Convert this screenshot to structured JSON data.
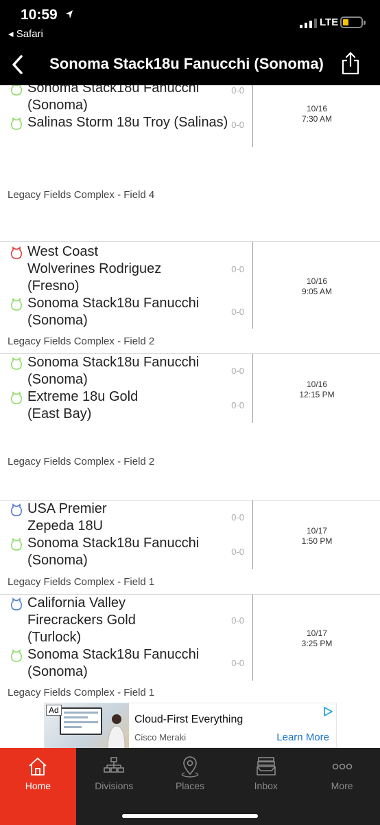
{
  "status_bar": {
    "time": "10:59",
    "back_app": "◂ Safari",
    "network": "LTE"
  },
  "nav": {
    "title": "Sonoma Stack18u Fanucchi (Sonoma)"
  },
  "games": [
    {
      "team1": {
        "name": "Sonoma Stack18u Fanucchi (Sonoma)",
        "score": "0-0",
        "icon_color": "#8fdc6a"
      },
      "team2": {
        "name": "Salinas Storm 18u Troy (Salinas)",
        "score": "0-0",
        "icon_color": "#8fdc6a"
      },
      "date": "10/16",
      "time": "7:30 AM",
      "venue": "Legacy Fields Complex - Field 4"
    },
    {
      "team1": {
        "name": "West Coast Wolverines Rodriguez (Fresno)",
        "score": "0-0",
        "icon_color": "#e23b3b"
      },
      "team2": {
        "name": "Sonoma Stack18u Fanucchi (Sonoma)",
        "score": "0-0",
        "icon_color": "#8fdc6a"
      },
      "date": "10/16",
      "time": "9:05 AM",
      "venue": "Legacy Fields Complex - Field 2"
    },
    {
      "team1": {
        "name": "Sonoma Stack18u Fanucchi (Sonoma)",
        "score": "0-0",
        "icon_color": "#8fdc6a"
      },
      "team2": {
        "name": "Extreme 18u Gold (East Bay)",
        "score": "0-0",
        "icon_color": "#8fdc6a"
      },
      "date": "10/16",
      "time": "12:15 PM",
      "venue": "Legacy Fields Complex - Field 2"
    },
    {
      "team1": {
        "name": "USA Premier Zepeda 18U",
        "score": "0-0",
        "icon_color": "#5a78d6"
      },
      "team2": {
        "name": "Sonoma Stack18u Fanucchi (Sonoma)",
        "score": "0-0",
        "icon_color": "#8fdc6a"
      },
      "date": "10/17",
      "time": "1:50 PM",
      "venue": "Legacy Fields Complex - Field 1"
    },
    {
      "team1": {
        "name": "California Valley Firecrackers Gold (Turlock)",
        "score": "0-0",
        "icon_color": "#4a86c6"
      },
      "team2": {
        "name": "Sonoma Stack18u Fanucchi (Sonoma)",
        "score": "0-0",
        "icon_color": "#8fdc6a"
      },
      "date": "10/17",
      "time": "3:25 PM",
      "venue": "Legacy Fields Complex - Field 1"
    }
  ],
  "ad": {
    "badge": "Ad",
    "headline": "Cloud-First Everything",
    "brand": "Cisco Meraki",
    "cta": "Learn More"
  },
  "tabs": [
    {
      "label": "Home",
      "icon": "home-icon",
      "active": true
    },
    {
      "label": "Divisions",
      "icon": "divisions-icon",
      "active": false
    },
    {
      "label": "Places",
      "icon": "places-icon",
      "active": false
    },
    {
      "label": "Inbox",
      "icon": "inbox-icon",
      "active": false
    },
    {
      "label": "More",
      "icon": "more-icon",
      "active": false
    }
  ],
  "colors": {
    "accent": "#e8321e",
    "bar": "#000000",
    "tabbar": "#1f1f1f"
  }
}
